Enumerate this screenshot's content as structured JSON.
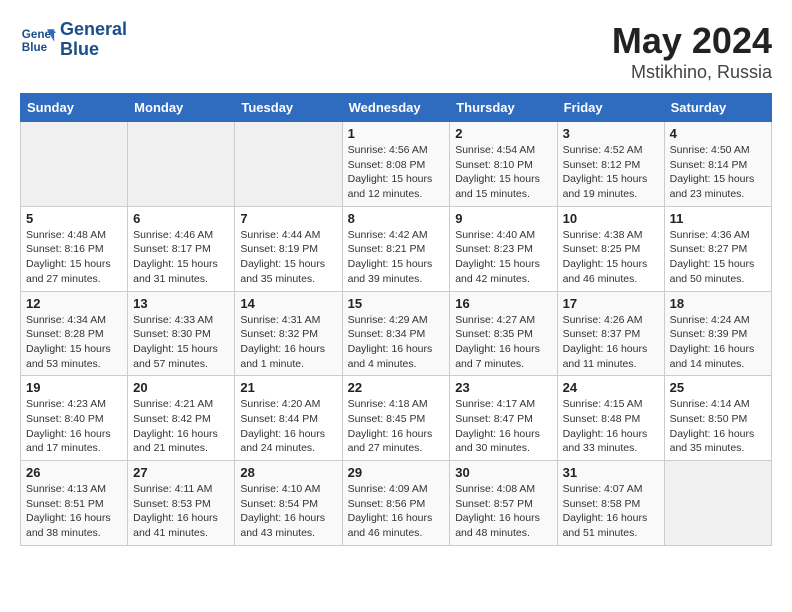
{
  "header": {
    "logo_line1": "General",
    "logo_line2": "Blue",
    "title": "May 2024",
    "subtitle": "Mstikhino, Russia"
  },
  "calendar": {
    "weekdays": [
      "Sunday",
      "Monday",
      "Tuesday",
      "Wednesday",
      "Thursday",
      "Friday",
      "Saturday"
    ],
    "rows": [
      [
        {
          "day": "",
          "info": ""
        },
        {
          "day": "",
          "info": ""
        },
        {
          "day": "",
          "info": ""
        },
        {
          "day": "1",
          "info": "Sunrise: 4:56 AM\nSunset: 8:08 PM\nDaylight: 15 hours\nand 12 minutes."
        },
        {
          "day": "2",
          "info": "Sunrise: 4:54 AM\nSunset: 8:10 PM\nDaylight: 15 hours\nand 15 minutes."
        },
        {
          "day": "3",
          "info": "Sunrise: 4:52 AM\nSunset: 8:12 PM\nDaylight: 15 hours\nand 19 minutes."
        },
        {
          "day": "4",
          "info": "Sunrise: 4:50 AM\nSunset: 8:14 PM\nDaylight: 15 hours\nand 23 minutes."
        }
      ],
      [
        {
          "day": "5",
          "info": "Sunrise: 4:48 AM\nSunset: 8:16 PM\nDaylight: 15 hours\nand 27 minutes."
        },
        {
          "day": "6",
          "info": "Sunrise: 4:46 AM\nSunset: 8:17 PM\nDaylight: 15 hours\nand 31 minutes."
        },
        {
          "day": "7",
          "info": "Sunrise: 4:44 AM\nSunset: 8:19 PM\nDaylight: 15 hours\nand 35 minutes."
        },
        {
          "day": "8",
          "info": "Sunrise: 4:42 AM\nSunset: 8:21 PM\nDaylight: 15 hours\nand 39 minutes."
        },
        {
          "day": "9",
          "info": "Sunrise: 4:40 AM\nSunset: 8:23 PM\nDaylight: 15 hours\nand 42 minutes."
        },
        {
          "day": "10",
          "info": "Sunrise: 4:38 AM\nSunset: 8:25 PM\nDaylight: 15 hours\nand 46 minutes."
        },
        {
          "day": "11",
          "info": "Sunrise: 4:36 AM\nSunset: 8:27 PM\nDaylight: 15 hours\nand 50 minutes."
        }
      ],
      [
        {
          "day": "12",
          "info": "Sunrise: 4:34 AM\nSunset: 8:28 PM\nDaylight: 15 hours\nand 53 minutes."
        },
        {
          "day": "13",
          "info": "Sunrise: 4:33 AM\nSunset: 8:30 PM\nDaylight: 15 hours\nand 57 minutes."
        },
        {
          "day": "14",
          "info": "Sunrise: 4:31 AM\nSunset: 8:32 PM\nDaylight: 16 hours\nand 1 minute."
        },
        {
          "day": "15",
          "info": "Sunrise: 4:29 AM\nSunset: 8:34 PM\nDaylight: 16 hours\nand 4 minutes."
        },
        {
          "day": "16",
          "info": "Sunrise: 4:27 AM\nSunset: 8:35 PM\nDaylight: 16 hours\nand 7 minutes."
        },
        {
          "day": "17",
          "info": "Sunrise: 4:26 AM\nSunset: 8:37 PM\nDaylight: 16 hours\nand 11 minutes."
        },
        {
          "day": "18",
          "info": "Sunrise: 4:24 AM\nSunset: 8:39 PM\nDaylight: 16 hours\nand 14 minutes."
        }
      ],
      [
        {
          "day": "19",
          "info": "Sunrise: 4:23 AM\nSunset: 8:40 PM\nDaylight: 16 hours\nand 17 minutes."
        },
        {
          "day": "20",
          "info": "Sunrise: 4:21 AM\nSunset: 8:42 PM\nDaylight: 16 hours\nand 21 minutes."
        },
        {
          "day": "21",
          "info": "Sunrise: 4:20 AM\nSunset: 8:44 PM\nDaylight: 16 hours\nand 24 minutes."
        },
        {
          "day": "22",
          "info": "Sunrise: 4:18 AM\nSunset: 8:45 PM\nDaylight: 16 hours\nand 27 minutes."
        },
        {
          "day": "23",
          "info": "Sunrise: 4:17 AM\nSunset: 8:47 PM\nDaylight: 16 hours\nand 30 minutes."
        },
        {
          "day": "24",
          "info": "Sunrise: 4:15 AM\nSunset: 8:48 PM\nDaylight: 16 hours\nand 33 minutes."
        },
        {
          "day": "25",
          "info": "Sunrise: 4:14 AM\nSunset: 8:50 PM\nDaylight: 16 hours\nand 35 minutes."
        }
      ],
      [
        {
          "day": "26",
          "info": "Sunrise: 4:13 AM\nSunset: 8:51 PM\nDaylight: 16 hours\nand 38 minutes."
        },
        {
          "day": "27",
          "info": "Sunrise: 4:11 AM\nSunset: 8:53 PM\nDaylight: 16 hours\nand 41 minutes."
        },
        {
          "day": "28",
          "info": "Sunrise: 4:10 AM\nSunset: 8:54 PM\nDaylight: 16 hours\nand 43 minutes."
        },
        {
          "day": "29",
          "info": "Sunrise: 4:09 AM\nSunset: 8:56 PM\nDaylight: 16 hours\nand 46 minutes."
        },
        {
          "day": "30",
          "info": "Sunrise: 4:08 AM\nSunset: 8:57 PM\nDaylight: 16 hours\nand 48 minutes."
        },
        {
          "day": "31",
          "info": "Sunrise: 4:07 AM\nSunset: 8:58 PM\nDaylight: 16 hours\nand 51 minutes."
        },
        {
          "day": "",
          "info": ""
        }
      ]
    ]
  }
}
